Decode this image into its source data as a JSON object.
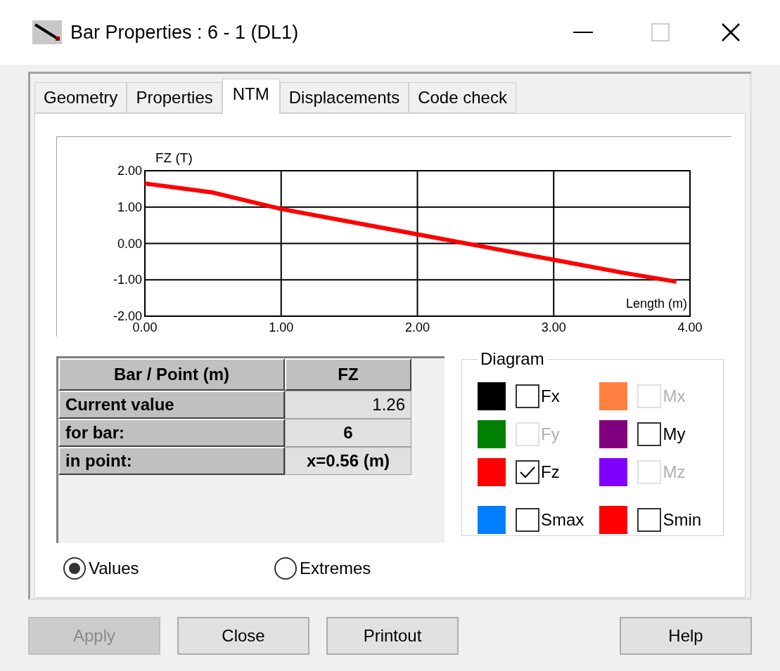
{
  "window": {
    "title": "Bar Properties : 6 - 1 (DL1)"
  },
  "tabs": [
    {
      "label": "Geometry",
      "selected": false
    },
    {
      "label": "Properties",
      "selected": false
    },
    {
      "label": "NTM",
      "selected": true
    },
    {
      "label": "Displacements",
      "selected": false
    },
    {
      "label": "Code check",
      "selected": false
    }
  ],
  "chart": {
    "chart_data": {
      "type": "line",
      "ylabel": "FZ (T)",
      "xlabel": "Length (m)",
      "xlim": [
        0,
        4
      ],
      "ylim": [
        -2,
        2
      ],
      "xticks": [
        {
          "value": 0,
          "label": "0.00"
        },
        {
          "value": 1,
          "label": "1.00"
        },
        {
          "value": 2,
          "label": "2.00"
        },
        {
          "value": 3,
          "label": "3.00"
        },
        {
          "value": 4,
          "label": "4.00"
        }
      ],
      "yticks": [
        {
          "value": 2,
          "label": "2.00"
        },
        {
          "value": 1,
          "label": "1.00"
        },
        {
          "value": 0,
          "label": "0.00"
        },
        {
          "value": -1,
          "label": "-1.00"
        },
        {
          "value": -2,
          "label": "-2.00"
        }
      ],
      "x": [
        0,
        0.5,
        1,
        1.5,
        2,
        2.5,
        3,
        3.5,
        3.9
      ],
      "grid": true,
      "series": [
        {
          "color": "#ff0000",
          "values": [
            1.65,
            1.4,
            0.95,
            0.6,
            0.25,
            -0.1,
            -0.45,
            -0.8,
            -1.05
          ]
        }
      ]
    }
  },
  "table": {
    "columns": [
      "Bar / Point (m)",
      "FZ"
    ],
    "rows": [
      {
        "label": "Current value",
        "value": "1.26"
      },
      {
        "label": "for bar:",
        "value": "6"
      },
      {
        "label": "in point:",
        "value": "x=0.56 (m)"
      }
    ]
  },
  "diagram": {
    "title": "Diagram",
    "items": [
      {
        "label": "Fx",
        "color": "#000000",
        "checked": false,
        "disabled": false
      },
      {
        "label": "Mx",
        "color": "#ff8040",
        "checked": false,
        "disabled": true
      },
      {
        "label": "Fy",
        "color": "#008000",
        "checked": false,
        "disabled": true
      },
      {
        "label": "My",
        "color": "#800080",
        "checked": false,
        "disabled": false
      },
      {
        "label": "Fz",
        "color": "#ff0000",
        "checked": true,
        "disabled": false
      },
      {
        "label": "Mz",
        "color": "#8000ff",
        "checked": false,
        "disabled": true
      },
      {
        "label": "Smax",
        "color": "#0080ff",
        "checked": false,
        "disabled": false
      },
      {
        "label": "Smin",
        "color": "#ff0000",
        "checked": false,
        "disabled": false
      }
    ]
  },
  "mode": [
    {
      "label": "Values",
      "selected": true
    },
    {
      "label": "Extremes",
      "selected": false
    }
  ],
  "buttons": [
    {
      "label": "Apply",
      "disabled": true
    },
    {
      "label": "Close",
      "disabled": false
    },
    {
      "label": "Printout",
      "disabled": false
    },
    {
      "label": "Help",
      "disabled": false
    }
  ]
}
